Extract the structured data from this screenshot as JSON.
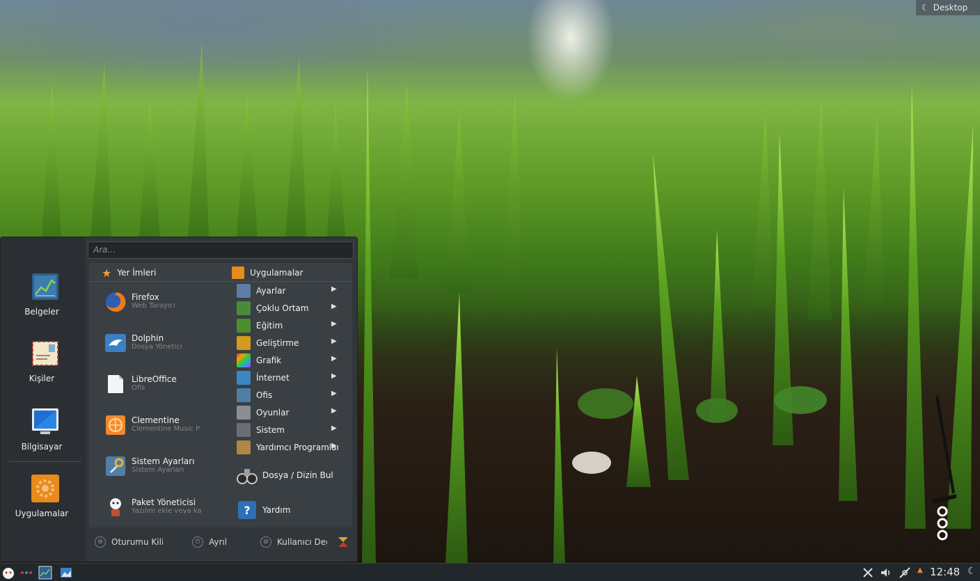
{
  "desktop": {
    "corner_label": "Desktop",
    "corner_icon": "moon-icon"
  },
  "menu": {
    "search_placeholder": "Ara...",
    "sidebar": [
      {
        "label": "Belgeler",
        "icon": "chart-document-icon"
      },
      {
        "label": "Kişiler",
        "icon": "address-card-icon"
      },
      {
        "label": "Bilgisayar",
        "icon": "monitor-icon"
      },
      {
        "label": "Uygulamalar",
        "icon": "gear-apps-icon"
      }
    ],
    "bookmarks_header": "Yer İmleri",
    "apps_header": "Uygulamalar",
    "favorites": [
      {
        "name": "Firefox",
        "desc": "Web Tarayıcı",
        "icon": "firefox-icon"
      },
      {
        "name": "Dolphin",
        "desc": "Dosya Yönetici",
        "icon": "dolphin-icon"
      },
      {
        "name": "LibreOffice",
        "desc": "Ofis",
        "icon": "libreoffice-icon"
      },
      {
        "name": "Clementine",
        "desc": "Clementine Music P",
        "icon": "clementine-icon"
      },
      {
        "name": "Sistem Ayarları",
        "desc": "Sistem Ayarları",
        "icon": "system-settings-icon"
      },
      {
        "name": "Paket Yöneticisi",
        "desc": "Yazılım ekle veya ka",
        "icon": "package-manager-icon"
      }
    ],
    "categories": [
      {
        "name": "Ayarlar",
        "icon": "settings-icon",
        "color": "#5d7ea3"
      },
      {
        "name": "Çoklu Ortam",
        "icon": "multimedia-icon",
        "color": "#4a8b3a"
      },
      {
        "name": "Eğitim",
        "icon": "education-icon",
        "color": "#4b8d2f"
      },
      {
        "name": "Geliştirme",
        "icon": "development-icon",
        "color": "#d59a1c"
      },
      {
        "name": "Grafik",
        "icon": "graphics-icon",
        "color": "#c23f9c"
      },
      {
        "name": "İnternet",
        "icon": "internet-icon",
        "color": "#3d86c6"
      },
      {
        "name": "Ofis",
        "icon": "office-icon",
        "color": "#4f7fa8"
      },
      {
        "name": "Oyunlar",
        "icon": "games-icon",
        "color": "#8b8f93"
      },
      {
        "name": "Sistem",
        "icon": "system-icon",
        "color": "#6a6f74"
      },
      {
        "name": "Yardımcı Programlar",
        "icon": "utilities-icon",
        "color": "#b38642"
      }
    ],
    "arrow": "▶",
    "find_files": {
      "name": "Dosya / Dizin Bul",
      "icon": "binoculars-icon"
    },
    "help": {
      "name": "Yardım",
      "icon": "help-icon"
    },
    "session": {
      "lock": "Oturumu Kilit",
      "leave": "Ayrıl",
      "switch_user": "Kullanıcı Değ"
    }
  },
  "taskbar": {
    "clock": "12:48"
  }
}
